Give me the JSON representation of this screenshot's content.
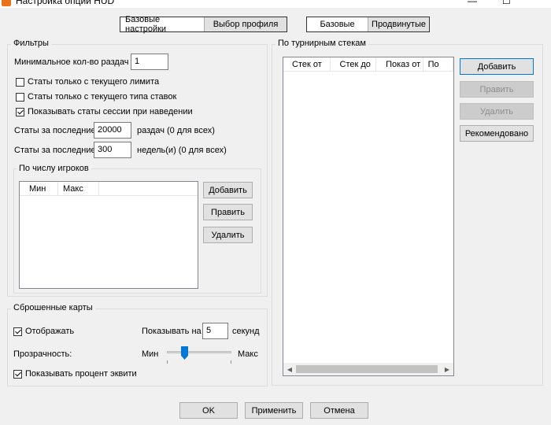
{
  "window": {
    "title": "Настройка опций HUD",
    "minimize_glyph": "—",
    "maximize_glyph": "☐"
  },
  "top_tabs": {
    "left": [
      {
        "label": "Базовые настройки",
        "active": false
      },
      {
        "label": "Выбор профиля",
        "active": true
      }
    ],
    "right": [
      {
        "label": "Базовые",
        "active": false
      },
      {
        "label": "Продвинутые",
        "active": true
      }
    ]
  },
  "filters": {
    "title": "Фильтры",
    "min_hands_label": "Минимальное кол-во раздач",
    "min_hands_value": "1",
    "checkboxes": [
      {
        "label": "Статы только с текущего лимита",
        "checked": false
      },
      {
        "label": "Статы только с текущего типа ставок",
        "checked": false
      },
      {
        "label": "Показывать статы сессии при наведении",
        "checked": true
      }
    ],
    "last_hands_label": "Статы за последние",
    "last_hands_value": "20000",
    "last_hands_suffix": "раздач (0 для всех)",
    "last_weeks_label": "Статы за последние",
    "last_weeks_value": "300",
    "last_weeks_suffix": "недель(и) (0 для всех)",
    "players": {
      "title": "По числу игроков",
      "columns": [
        "Мин",
        "Макс"
      ],
      "rows": [],
      "buttons": {
        "add": "Добавить",
        "edit": "Править",
        "delete": "Удалить"
      }
    }
  },
  "tournament": {
    "title": "По турнирным стекам",
    "columns": [
      "Стек от",
      "Стек до",
      "Показ от",
      "По"
    ],
    "rows": [],
    "buttons": {
      "add": "Добавить",
      "edit": "Править",
      "delete": "Удалить",
      "recommended": "Рекомендовано"
    }
  },
  "folded": {
    "title": "Сброшенные карты",
    "display_label": "Отображать",
    "display_checked": true,
    "show_for_label": "Показывать на",
    "show_for_value": "5",
    "show_for_suffix": "секунд",
    "transparency_label": "Прозрачность:",
    "slider_min": "Мин",
    "slider_max": "Макс",
    "slider_value_fraction": 0.25,
    "equity_label": "Показывать процент эквити",
    "equity_checked": true
  },
  "footer": {
    "ok": "OK",
    "apply": "Применить",
    "cancel": "Отмена"
  },
  "colors": {
    "accent": "#0078d7",
    "icon": "#e8731a"
  }
}
